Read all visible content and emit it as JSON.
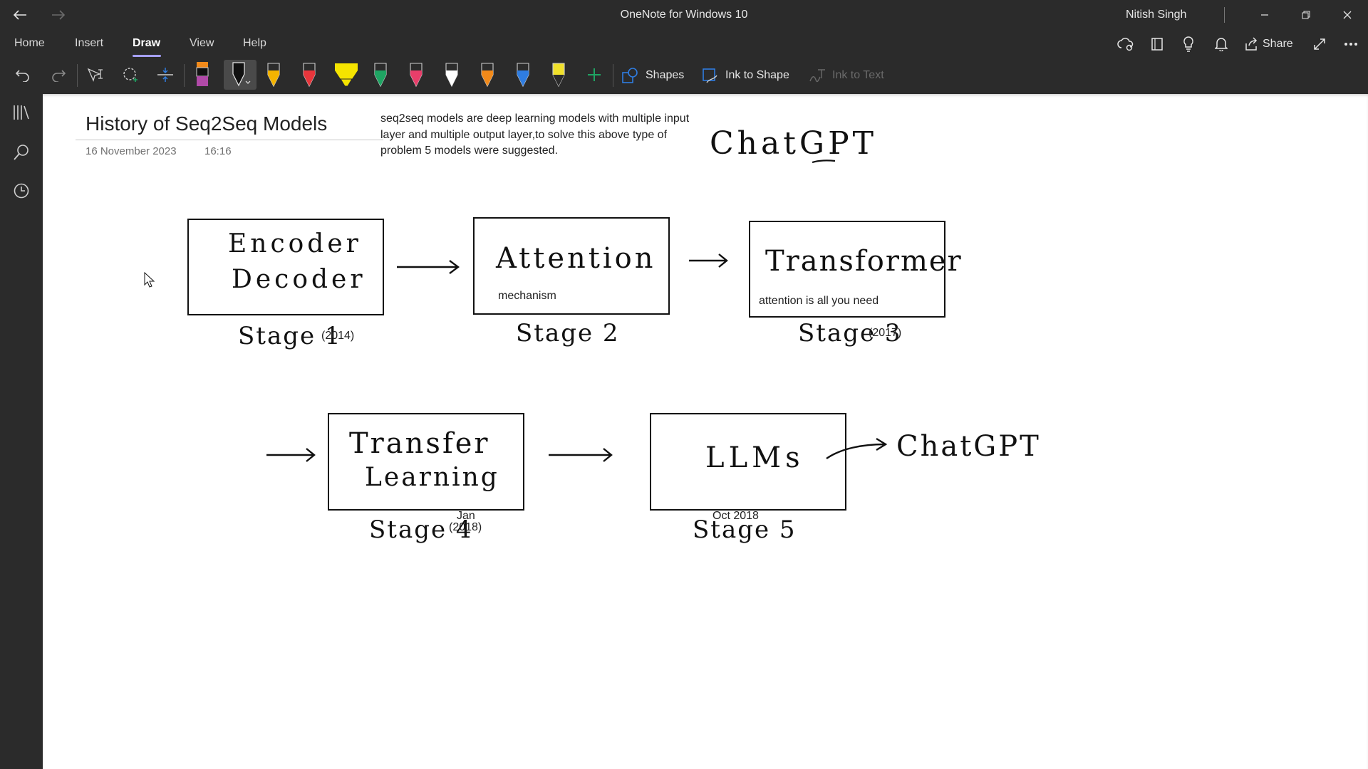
{
  "window": {
    "title": "OneNote for Windows 10",
    "user": "Nitish Singh"
  },
  "menu": {
    "tabs": [
      "Home",
      "Insert",
      "Draw",
      "View",
      "Help"
    ],
    "active": "Draw",
    "share_label": "Share"
  },
  "toolbar": {
    "shapes_label": "Shapes",
    "ink_to_shape_label": "Ink to Shape",
    "ink_to_text_label": "Ink to Text",
    "pen_colors": [
      "#2b2b2b",
      "#f4b400",
      "#e8363c",
      "#f5e400",
      "#1fa463",
      "#e83e6a",
      "#ffffff",
      "#f28a1a",
      "#2f7de1",
      "#f0e02a"
    ],
    "accent": "#a6a0ff"
  },
  "page": {
    "title": "History of Seq2Seq Models",
    "date": "16 November 2023",
    "time": "16:16",
    "note": "seq2seq models are deep learning models with multiple input layer and multiple output layer,to solve this above type of problem 5 models were suggested.",
    "ink_header": "ChatGPT"
  },
  "diagram": {
    "stages": [
      {
        "ink_lines": [
          "Encoder",
          "Decoder"
        ],
        "ink_label": "Stage 1",
        "typed_year": "(2014)",
        "typed_note": ""
      },
      {
        "ink_lines": [
          "Attention"
        ],
        "ink_label": "Stage 2",
        "typed_year": "",
        "typed_note": "mechanism"
      },
      {
        "ink_lines": [
          "Transformer"
        ],
        "ink_label": "Stage 3",
        "typed_year": "(2017)",
        "typed_note": "attention is all you need"
      },
      {
        "ink_lines": [
          "Transfer",
          "Learning"
        ],
        "ink_label": "Stage 4",
        "typed_year": "(2018)",
        "typed_month": "Jan",
        "typed_note": ""
      },
      {
        "ink_lines": [
          "LLMs"
        ],
        "ink_label": "Stage 5",
        "typed_year": "Oct 2018",
        "typed_note": ""
      }
    ],
    "final_ink": "ChatGPT"
  }
}
